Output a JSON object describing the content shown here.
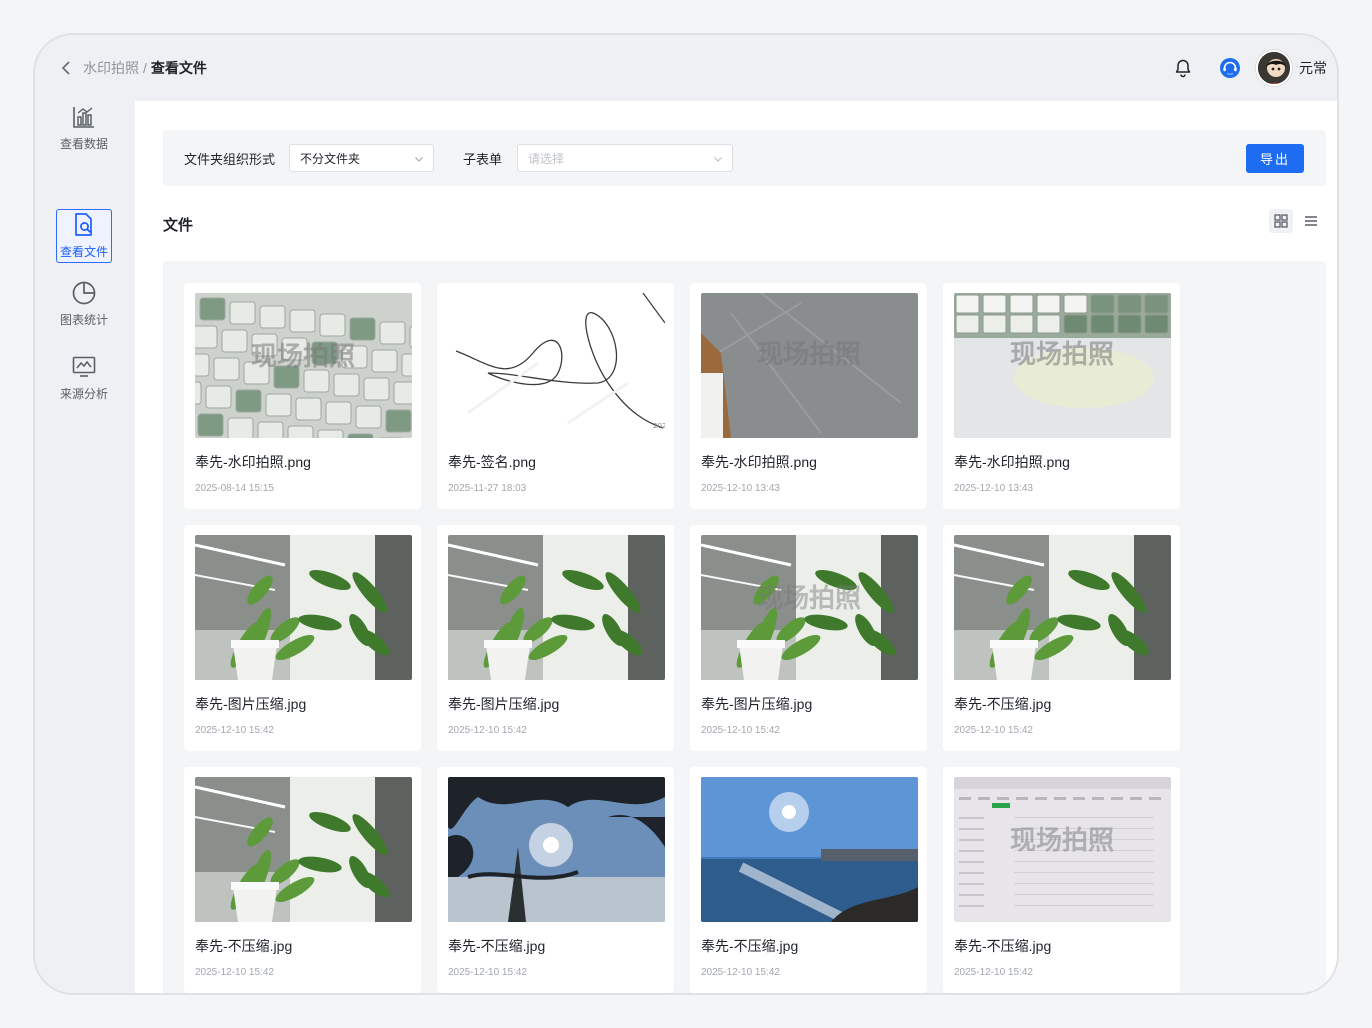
{
  "header": {
    "breadcrumb_parent": "水印拍照",
    "breadcrumb_sep": "/",
    "breadcrumb_current": "查看文件",
    "user_name": "元常"
  },
  "sidebar": {
    "items": [
      {
        "label": "查看数据",
        "icon": "bar-chart-icon",
        "active": false
      },
      {
        "label": "查看文件",
        "icon": "file-search-icon",
        "active": true
      },
      {
        "label": "图表统计",
        "icon": "pie-chart-icon",
        "active": false
      },
      {
        "label": "来源分析",
        "icon": "monitor-chart-icon",
        "active": false
      }
    ]
  },
  "filters": {
    "folder_label": "文件夹组织形式",
    "folder_value": "不分文件夹",
    "subform_label": "子表单",
    "subform_placeholder": "请选择",
    "export_label": "导出"
  },
  "files_title": "文件",
  "watermark_text": "现场拍照",
  "files": [
    {
      "name": "奉先-水印拍照.png",
      "date": "2025-08-14 15:15",
      "thumb": "keyboard-watermark"
    },
    {
      "name": "奉先-签名.png",
      "date": "2025-11-27 18:03",
      "thumb": "signature"
    },
    {
      "name": "奉先-水印拍照.png",
      "date": "2025-12-10 13:43",
      "thumb": "floor-watermark"
    },
    {
      "name": "奉先-水印拍照.png",
      "date": "2025-12-10 13:43",
      "thumb": "keyboard-top-watermark"
    },
    {
      "name": "奉先-图片压缩.jpg",
      "date": "2025-12-10 15:42",
      "thumb": "plant"
    },
    {
      "name": "奉先-图片压缩.jpg",
      "date": "2025-12-10 15:42",
      "thumb": "plant"
    },
    {
      "name": "奉先-图片压缩.jpg",
      "date": "2025-12-10 15:42",
      "thumb": "plant-watermark"
    },
    {
      "name": "奉先-不压缩.jpg",
      "date": "2025-12-10 15:42",
      "thumb": "plant"
    },
    {
      "name": "奉先-不压缩.jpg",
      "date": "2025-12-10 15:42",
      "thumb": "plant"
    },
    {
      "name": "奉先-不压缩.jpg",
      "date": "2025-12-10 15:42",
      "thumb": "pine-sun"
    },
    {
      "name": "奉先-不压缩.jpg",
      "date": "2025-12-10 15:42",
      "thumb": "sea-sun"
    },
    {
      "name": "奉先-不压缩.jpg",
      "date": "2025-12-10 15:42",
      "thumb": "screen-watermark"
    }
  ],
  "colors": {
    "primary": "#1e6cf2",
    "active_nav": "#1e5eff"
  }
}
